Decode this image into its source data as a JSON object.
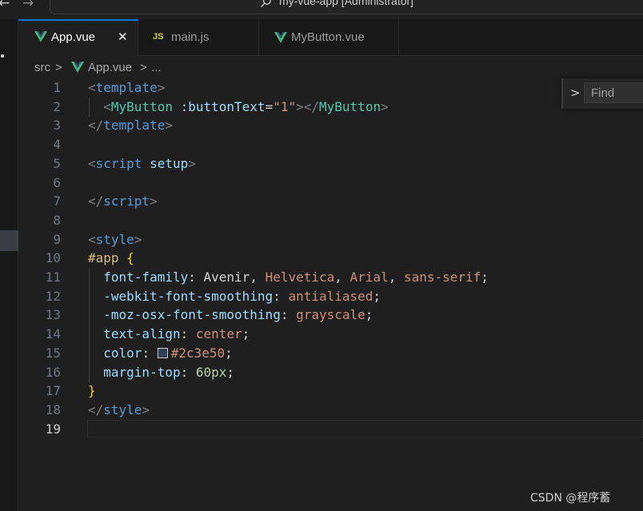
{
  "window": {
    "title": "my-vue-app [Administrator]",
    "nav_back": "←",
    "nav_forward": "→"
  },
  "tabs": [
    {
      "label": "App.vue",
      "icon": "vue-icon",
      "active": true,
      "close": "✕"
    },
    {
      "label": "main.js",
      "icon": "js-icon",
      "icon_text": "JS",
      "active": false
    },
    {
      "label": "MyButton.vue",
      "icon": "vue-icon",
      "active": false
    }
  ],
  "breadcrumb": {
    "folder": "src",
    "sep": ">",
    "file": "App.vue",
    "ellipsis": "..."
  },
  "find": {
    "chevron": ">",
    "placeholder": "Find"
  },
  "editor": {
    "line_numbers": [
      "1",
      "2",
      "3",
      "4",
      "5",
      "6",
      "7",
      "8",
      "9",
      "10",
      "11",
      "12",
      "13",
      "14",
      "15",
      "16",
      "17",
      "18",
      "19"
    ],
    "current_line": 19,
    "lines": [
      [
        {
          "t": "<",
          "c": "t-punc"
        },
        {
          "t": "template",
          "c": "t-tag"
        },
        {
          "t": ">",
          "c": "t-punc"
        }
      ],
      [
        {
          "t": "  ",
          "c": ""
        },
        {
          "t": "<",
          "c": "t-punc"
        },
        {
          "t": "MyButton",
          "c": "t-comp"
        },
        {
          "t": " :buttonText",
          "c": "t-attr"
        },
        {
          "t": "=",
          "c": "t-white"
        },
        {
          "t": "\"1\"",
          "c": "t-str"
        },
        {
          "t": "></",
          "c": "t-punc"
        },
        {
          "t": "MyButton",
          "c": "t-comp"
        },
        {
          "t": ">",
          "c": "t-punc"
        }
      ],
      [
        {
          "t": "</",
          "c": "t-punc"
        },
        {
          "t": "template",
          "c": "t-tag"
        },
        {
          "t": ">",
          "c": "t-punc"
        }
      ],
      [],
      [
        {
          "t": "<",
          "c": "t-punc"
        },
        {
          "t": "script",
          "c": "t-tag"
        },
        {
          "t": " setup",
          "c": "t-attr"
        },
        {
          "t": ">",
          "c": "t-punc"
        }
      ],
      [],
      [
        {
          "t": "</",
          "c": "t-punc"
        },
        {
          "t": "script",
          "c": "t-tag"
        },
        {
          "t": ">",
          "c": "t-punc"
        }
      ],
      [],
      [
        {
          "t": "<",
          "c": "t-punc"
        },
        {
          "t": "style",
          "c": "t-tag"
        },
        {
          "t": ">",
          "c": "t-punc"
        }
      ],
      [
        {
          "t": "#app",
          "c": "t-sel"
        },
        {
          "t": " ",
          "c": ""
        },
        {
          "t": "{",
          "c": "t-brace"
        }
      ],
      [
        {
          "t": "  ",
          "c": ""
        },
        {
          "t": "font-family",
          "c": "t-prop"
        },
        {
          "t": ": ",
          "c": "t-white"
        },
        {
          "t": "Avenir",
          "c": "t-white"
        },
        {
          "t": ", ",
          "c": "t-white"
        },
        {
          "t": "Helvetica",
          "c": "t-str"
        },
        {
          "t": ", ",
          "c": "t-white"
        },
        {
          "t": "Arial",
          "c": "t-str"
        },
        {
          "t": ", ",
          "c": "t-white"
        },
        {
          "t": "sans-serif",
          "c": "t-str"
        },
        {
          "t": ";",
          "c": "t-white"
        }
      ],
      [
        {
          "t": "  ",
          "c": ""
        },
        {
          "t": "-webkit-font-smoothing",
          "c": "t-prop"
        },
        {
          "t": ": ",
          "c": "t-white"
        },
        {
          "t": "antialiased",
          "c": "t-str"
        },
        {
          "t": ";",
          "c": "t-white"
        }
      ],
      [
        {
          "t": "  ",
          "c": ""
        },
        {
          "t": "-moz-osx-font-smoothing",
          "c": "t-prop"
        },
        {
          "t": ": ",
          "c": "t-white"
        },
        {
          "t": "grayscale",
          "c": "t-str"
        },
        {
          "t": ";",
          "c": "t-white"
        }
      ],
      [
        {
          "t": "  ",
          "c": ""
        },
        {
          "t": "text-align",
          "c": "t-prop"
        },
        {
          "t": ": ",
          "c": "t-white"
        },
        {
          "t": "center",
          "c": "t-str"
        },
        {
          "t": ";",
          "c": "t-white"
        }
      ],
      [
        {
          "t": "  ",
          "c": ""
        },
        {
          "t": "color",
          "c": "t-prop"
        },
        {
          "t": ": ",
          "c": "t-white"
        },
        {
          "swatch": "#2c3e50"
        },
        {
          "t": "#2c3e50",
          "c": "t-str"
        },
        {
          "t": ";",
          "c": "t-white"
        }
      ],
      [
        {
          "t": "  ",
          "c": ""
        },
        {
          "t": "margin-top",
          "c": "t-prop"
        },
        {
          "t": ": ",
          "c": "t-white"
        },
        {
          "t": "60px",
          "c": "t-num"
        },
        {
          "t": ";",
          "c": "t-white"
        }
      ],
      [
        {
          "t": "}",
          "c": "t-brace"
        }
      ],
      [
        {
          "t": "</",
          "c": "t-punc"
        },
        {
          "t": "style",
          "c": "t-tag"
        },
        {
          "t": ">",
          "c": "t-punc"
        }
      ],
      []
    ]
  },
  "watermark": "CSDN @程序蓄",
  "colors": {
    "accent": "#0078d4",
    "editor_bg": "#1f1f1f",
    "tabbar_bg": "#181818",
    "vue_green": "#41b883",
    "js_yellow": "#cbcb41"
  }
}
